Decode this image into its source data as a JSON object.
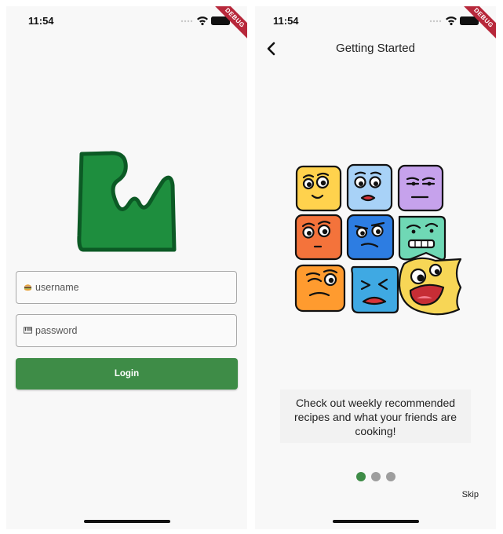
{
  "status_bar": {
    "time": "11:54",
    "debug_label": "DEBUG"
  },
  "login_screen": {
    "username_placeholder": "username",
    "password_placeholder": "password",
    "login_label": "Login"
  },
  "onboarding_screen": {
    "title": "Getting Started",
    "description": "Check out weekly recommended recipes and what your friends are cooking!",
    "skip_label": "Skip",
    "page_indicator": {
      "total": 3,
      "current": 1
    }
  },
  "colors": {
    "brand_green": "#3e8c47",
    "logo_fill": "#1e8e3e",
    "logo_stroke": "#0c5a25",
    "face_colors": [
      "#ffd24d",
      "#a8d2f7",
      "#c6a2ec",
      "#f4733b",
      "#2d7de2",
      "#6fd8b5",
      "#ff9b2f",
      "#3fa9e3",
      "#f7d656"
    ]
  }
}
